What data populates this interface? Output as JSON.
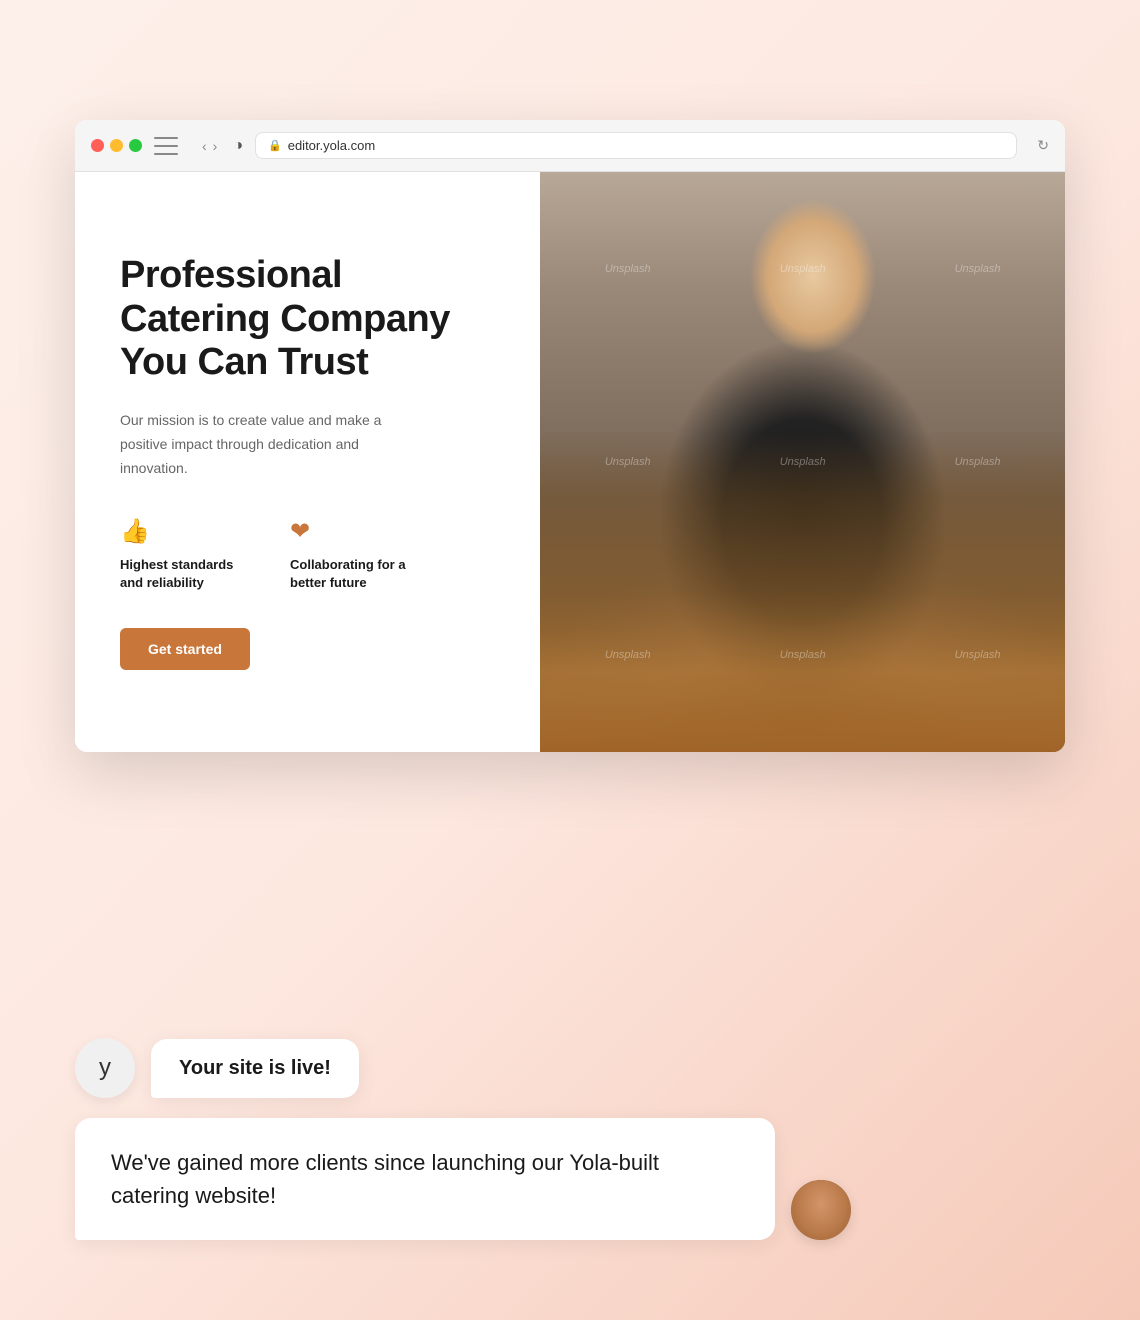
{
  "browser": {
    "url": "editor.yola.com",
    "dots": [
      "red",
      "yellow",
      "green"
    ]
  },
  "website": {
    "hero": {
      "title": "Professional Catering Company You Can Trust",
      "description": "Our mission is to create value and make a positive impact through dedication and innovation.",
      "features": [
        {
          "icon": "👍",
          "label": "Highest standards and reliability"
        },
        {
          "icon": "❤️",
          "label": "Collaborating for a better future"
        }
      ],
      "cta_label": "Get started"
    }
  },
  "chat": {
    "bot_avatar_letter": "y",
    "bot_message": "Your site is live!",
    "user_message": "We've gained more clients since launching our Yola-built catering website!"
  },
  "watermarks": [
    "Unsplash",
    "Unsplash",
    "Unsplash",
    "Unsplash",
    "Unsplash",
    "Unsplash",
    "Unsplash",
    "Unsplash",
    "Unsplash"
  ]
}
